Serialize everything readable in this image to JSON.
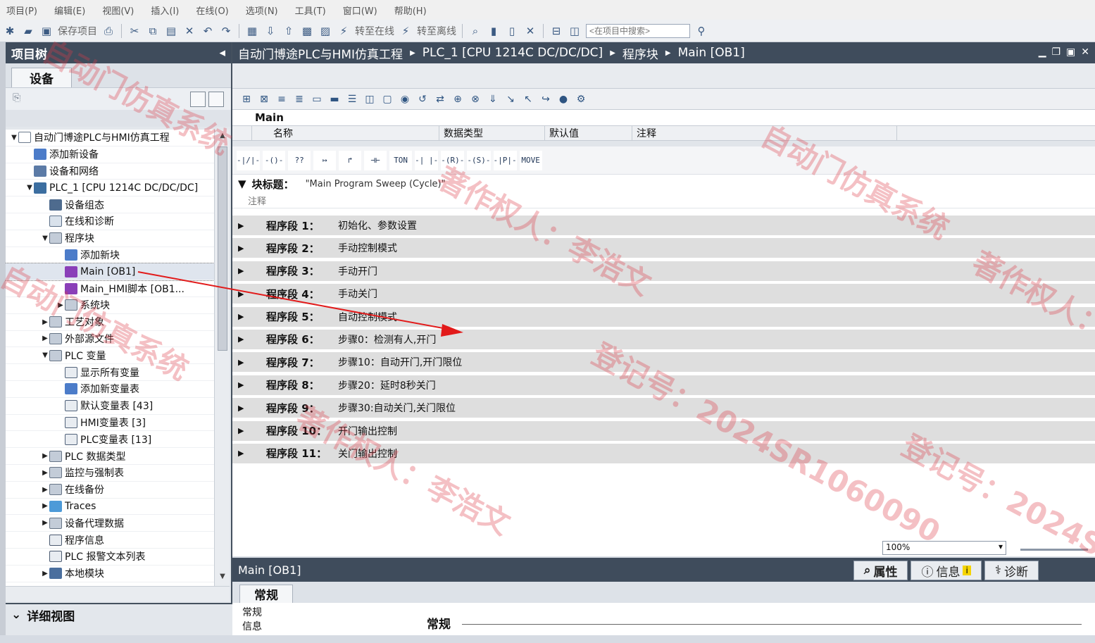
{
  "menu": [
    "项目(P)",
    "编辑(E)",
    "视图(V)",
    "插入(I)",
    "在线(O)",
    "选项(N)",
    "工具(T)",
    "窗口(W)",
    "帮助(H)"
  ],
  "toolbar": {
    "save_label": "保存项目",
    "go_online": "转至在线",
    "go_offline": "转至离线",
    "search_placeholder": "<在项目中搜索>"
  },
  "project_tree": {
    "header": "项目树",
    "tab": "设备",
    "items": [
      {
        "label": "自动门博途PLC与HMI仿真工程",
        "indent": 0,
        "expand": "down",
        "icon": "doc"
      },
      {
        "label": "添加新设备",
        "indent": 1,
        "expand": "",
        "icon": "star"
      },
      {
        "label": "设备和网络",
        "indent": 1,
        "expand": "",
        "icon": "net"
      },
      {
        "label": "PLC_1 [CPU 1214C DC/DC/DC]",
        "indent": 1,
        "expand": "down",
        "icon": "cpu"
      },
      {
        "label": "设备组态",
        "indent": 2,
        "expand": "",
        "icon": "cfg"
      },
      {
        "label": "在线和诊断",
        "indent": 2,
        "expand": "",
        "icon": "diag"
      },
      {
        "label": "程序块",
        "indent": 2,
        "expand": "down",
        "icon": "folder"
      },
      {
        "label": "添加新块",
        "indent": 3,
        "expand": "",
        "icon": "star"
      },
      {
        "label": "Main [OB1]",
        "indent": 3,
        "expand": "",
        "icon": "ob",
        "selected": true
      },
      {
        "label": "Main_HMI脚本 [OB1...",
        "indent": 3,
        "expand": "",
        "icon": "ob"
      },
      {
        "label": "系统块",
        "indent": 3,
        "expand": "right",
        "icon": "folder"
      },
      {
        "label": "工艺对象",
        "indent": 2,
        "expand": "right",
        "icon": "folder"
      },
      {
        "label": "外部源文件",
        "indent": 2,
        "expand": "right",
        "icon": "folder"
      },
      {
        "label": "PLC 变量",
        "indent": 2,
        "expand": "down",
        "icon": "folder"
      },
      {
        "label": "显示所有变量",
        "indent": 3,
        "expand": "",
        "icon": "tbl"
      },
      {
        "label": "添加新变量表",
        "indent": 3,
        "expand": "",
        "icon": "star"
      },
      {
        "label": "默认变量表 [43]",
        "indent": 3,
        "expand": "",
        "icon": "tbl"
      },
      {
        "label": "HMI变量表 [3]",
        "indent": 3,
        "expand": "",
        "icon": "tbl"
      },
      {
        "label": "PLC变量表 [13]",
        "indent": 3,
        "expand": "",
        "icon": "tbl"
      },
      {
        "label": "PLC 数据类型",
        "indent": 2,
        "expand": "right",
        "icon": "folder"
      },
      {
        "label": "监控与强制表",
        "indent": 2,
        "expand": "right",
        "icon": "folder"
      },
      {
        "label": "在线备份",
        "indent": 2,
        "expand": "right",
        "icon": "folder"
      },
      {
        "label": "Traces",
        "indent": 2,
        "expand": "right",
        "icon": "trace"
      },
      {
        "label": "设备代理数据",
        "indent": 2,
        "expand": "right",
        "icon": "folder"
      },
      {
        "label": "程序信息",
        "indent": 2,
        "expand": "",
        "icon": "info"
      },
      {
        "label": "PLC 报警文本列表",
        "indent": 2,
        "expand": "",
        "icon": "info"
      },
      {
        "label": "本地模块",
        "indent": 2,
        "expand": "right",
        "icon": "mod"
      }
    ],
    "detail_view": "详细视图"
  },
  "editor": {
    "breadcrumb": [
      "自动门博途PLC与HMI仿真工程",
      "PLC_1 [CPU 1214C DC/DC/DC]",
      "程序块",
      "Main [OB1]"
    ],
    "interface_title": "Main",
    "columns": [
      "名称",
      "数据类型",
      "默认值",
      "注释"
    ],
    "ladder_buttons": [
      "-|/|-",
      "-()-",
      "??",
      "↦",
      "↱",
      "⊣⊢",
      "TON",
      "-| |-",
      "-(R)-",
      "-(S)-",
      "-|P|-",
      "MOVE"
    ],
    "block_title_label": "块标题：",
    "block_title_value": "\"Main Program Sweep (Cycle)\"",
    "block_comment": "注释",
    "networks": [
      {
        "label": "程序段 1：",
        "title": "初始化、参数设置"
      },
      {
        "label": "程序段 2：",
        "title": "手动控制模式"
      },
      {
        "label": "程序段 3：",
        "title": "手动开门"
      },
      {
        "label": "程序段 4：",
        "title": "手动关门"
      },
      {
        "label": "程序段 5：",
        "title": "自动控制模式"
      },
      {
        "label": "程序段 6：",
        "title": "步骤0：检测有人,开门"
      },
      {
        "label": "程序段 7：",
        "title": "步骤10：自动开门,开门限位"
      },
      {
        "label": "程序段 8：",
        "title": "步骤20：延时8秒关门"
      },
      {
        "label": "程序段 9：",
        "title": "步骤30:自动关门,关门限位"
      },
      {
        "label": "程序段 10：",
        "title": "开门输出控制"
      },
      {
        "label": "程序段 11：",
        "title": "关门输出控制"
      }
    ],
    "zoom": "100%"
  },
  "inspector": {
    "title": "Main [OB1]",
    "tabs": [
      "属性",
      "信息",
      "诊断"
    ],
    "sub_tab": "常规",
    "nav": [
      "常规",
      "信息"
    ],
    "section": "常规"
  },
  "watermark": {
    "lines": [
      "自动门仿真系统",
      "著作权人：李浩文",
      "登记号：2024SR1060090"
    ],
    "color": "#dc3c46"
  }
}
